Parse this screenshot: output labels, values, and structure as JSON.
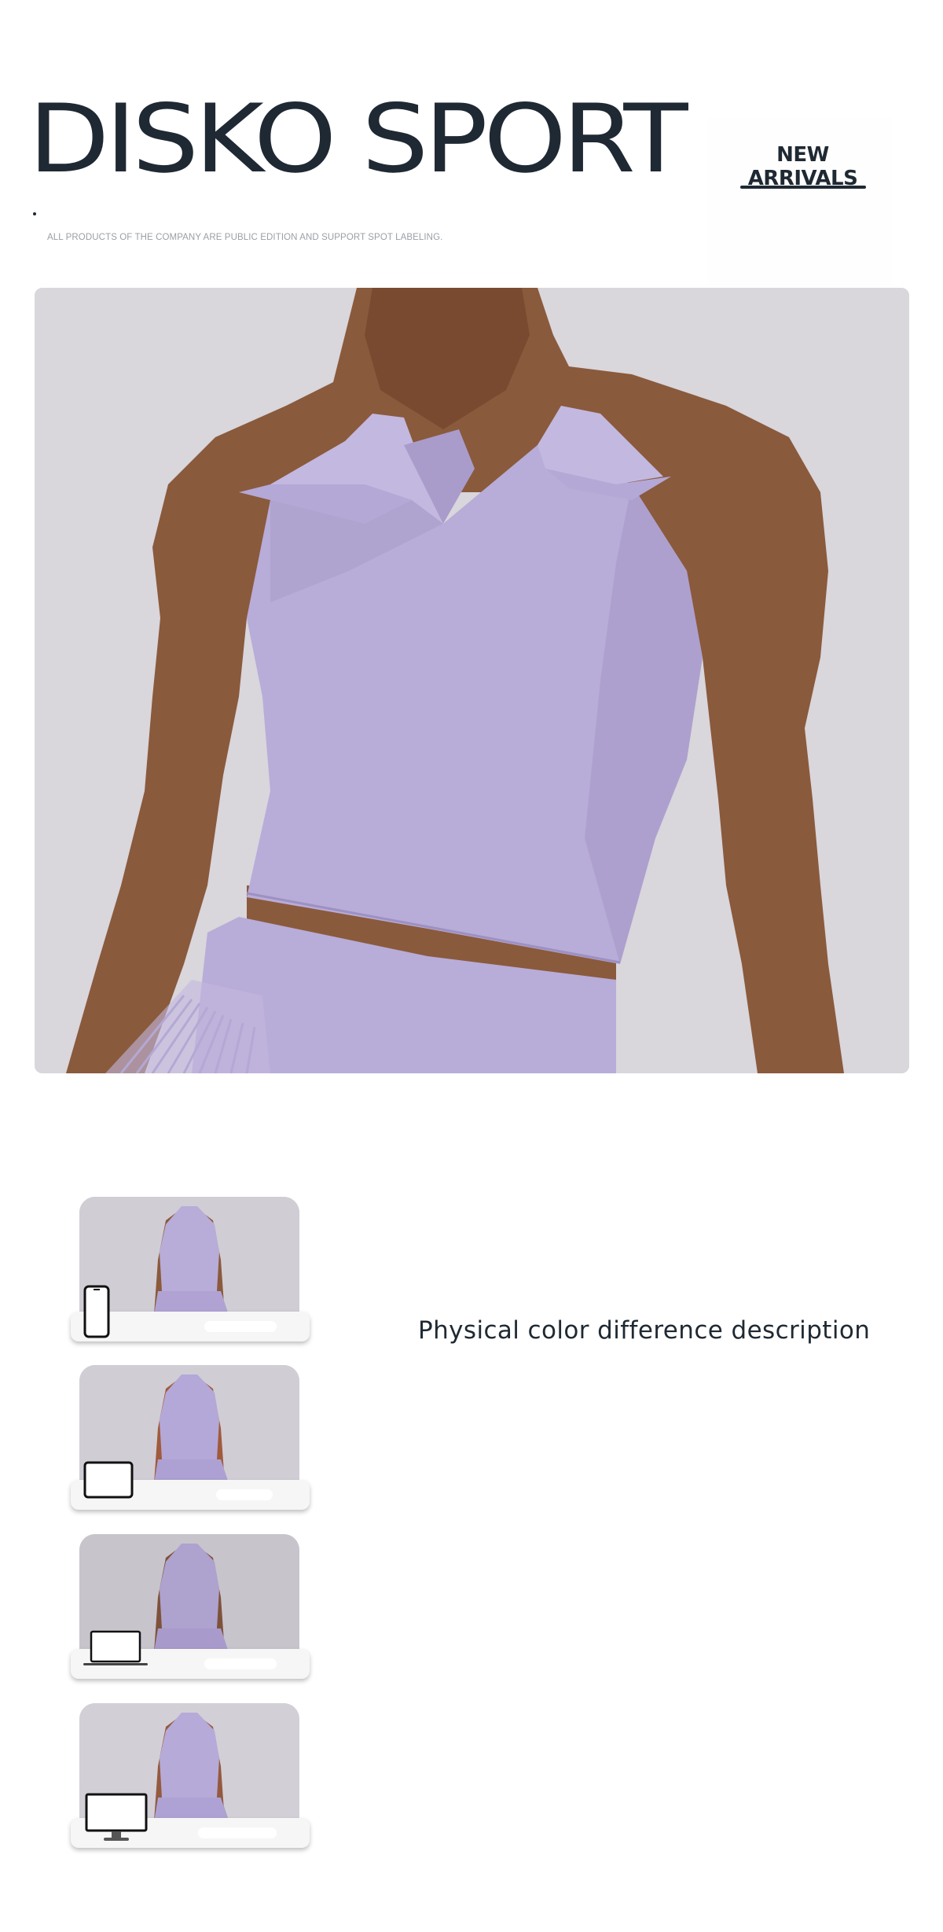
{
  "header": {
    "brand": "DISKO SPORT",
    "disclaimer": "ALL PRODUCTS OF THE COMPANY ARE PUBLIC EDITION AND SUPPORT SPOT LABELING.",
    "new_arrivals": "NEW ARRIVALS"
  },
  "product": {
    "top_color": "#b8acd8",
    "skin_color": "#8a5a3c",
    "background_color": "#d9d6dc"
  },
  "color_difference": {
    "title": "Physical color difference description",
    "devices": [
      {
        "device": "phone-icon"
      },
      {
        "device": "tablet-icon"
      },
      {
        "device": "laptop-icon"
      },
      {
        "device": "desktop-monitor-icon"
      }
    ]
  }
}
